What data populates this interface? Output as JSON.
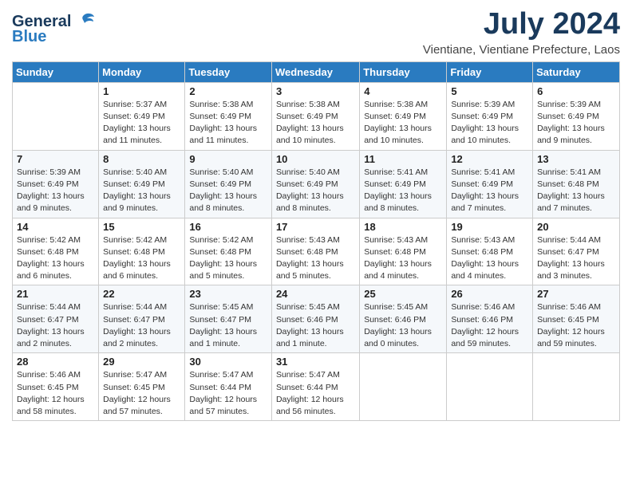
{
  "logo": {
    "general": "General",
    "blue": "Blue"
  },
  "title": "July 2024",
  "subtitle": "Vientiane, Vientiane Prefecture, Laos",
  "days_of_week": [
    "Sunday",
    "Monday",
    "Tuesday",
    "Wednesday",
    "Thursday",
    "Friday",
    "Saturday"
  ],
  "weeks": [
    [
      {
        "day": "",
        "sunrise": "",
        "sunset": "",
        "daylight": ""
      },
      {
        "day": "1",
        "sunrise": "Sunrise: 5:37 AM",
        "sunset": "Sunset: 6:49 PM",
        "daylight": "Daylight: 13 hours and 11 minutes."
      },
      {
        "day": "2",
        "sunrise": "Sunrise: 5:38 AM",
        "sunset": "Sunset: 6:49 PM",
        "daylight": "Daylight: 13 hours and 11 minutes."
      },
      {
        "day": "3",
        "sunrise": "Sunrise: 5:38 AM",
        "sunset": "Sunset: 6:49 PM",
        "daylight": "Daylight: 13 hours and 10 minutes."
      },
      {
        "day": "4",
        "sunrise": "Sunrise: 5:38 AM",
        "sunset": "Sunset: 6:49 PM",
        "daylight": "Daylight: 13 hours and 10 minutes."
      },
      {
        "day": "5",
        "sunrise": "Sunrise: 5:39 AM",
        "sunset": "Sunset: 6:49 PM",
        "daylight": "Daylight: 13 hours and 10 minutes."
      },
      {
        "day": "6",
        "sunrise": "Sunrise: 5:39 AM",
        "sunset": "Sunset: 6:49 PM",
        "daylight": "Daylight: 13 hours and 9 minutes."
      }
    ],
    [
      {
        "day": "7",
        "sunrise": "Sunrise: 5:39 AM",
        "sunset": "Sunset: 6:49 PM",
        "daylight": "Daylight: 13 hours and 9 minutes."
      },
      {
        "day": "8",
        "sunrise": "Sunrise: 5:40 AM",
        "sunset": "Sunset: 6:49 PM",
        "daylight": "Daylight: 13 hours and 9 minutes."
      },
      {
        "day": "9",
        "sunrise": "Sunrise: 5:40 AM",
        "sunset": "Sunset: 6:49 PM",
        "daylight": "Daylight: 13 hours and 8 minutes."
      },
      {
        "day": "10",
        "sunrise": "Sunrise: 5:40 AM",
        "sunset": "Sunset: 6:49 PM",
        "daylight": "Daylight: 13 hours and 8 minutes."
      },
      {
        "day": "11",
        "sunrise": "Sunrise: 5:41 AM",
        "sunset": "Sunset: 6:49 PM",
        "daylight": "Daylight: 13 hours and 8 minutes."
      },
      {
        "day": "12",
        "sunrise": "Sunrise: 5:41 AM",
        "sunset": "Sunset: 6:49 PM",
        "daylight": "Daylight: 13 hours and 7 minutes."
      },
      {
        "day": "13",
        "sunrise": "Sunrise: 5:41 AM",
        "sunset": "Sunset: 6:48 PM",
        "daylight": "Daylight: 13 hours and 7 minutes."
      }
    ],
    [
      {
        "day": "14",
        "sunrise": "Sunrise: 5:42 AM",
        "sunset": "Sunset: 6:48 PM",
        "daylight": "Daylight: 13 hours and 6 minutes."
      },
      {
        "day": "15",
        "sunrise": "Sunrise: 5:42 AM",
        "sunset": "Sunset: 6:48 PM",
        "daylight": "Daylight: 13 hours and 6 minutes."
      },
      {
        "day": "16",
        "sunrise": "Sunrise: 5:42 AM",
        "sunset": "Sunset: 6:48 PM",
        "daylight": "Daylight: 13 hours and 5 minutes."
      },
      {
        "day": "17",
        "sunrise": "Sunrise: 5:43 AM",
        "sunset": "Sunset: 6:48 PM",
        "daylight": "Daylight: 13 hours and 5 minutes."
      },
      {
        "day": "18",
        "sunrise": "Sunrise: 5:43 AM",
        "sunset": "Sunset: 6:48 PM",
        "daylight": "Daylight: 13 hours and 4 minutes."
      },
      {
        "day": "19",
        "sunrise": "Sunrise: 5:43 AM",
        "sunset": "Sunset: 6:48 PM",
        "daylight": "Daylight: 13 hours and 4 minutes."
      },
      {
        "day": "20",
        "sunrise": "Sunrise: 5:44 AM",
        "sunset": "Sunset: 6:47 PM",
        "daylight": "Daylight: 13 hours and 3 minutes."
      }
    ],
    [
      {
        "day": "21",
        "sunrise": "Sunrise: 5:44 AM",
        "sunset": "Sunset: 6:47 PM",
        "daylight": "Daylight: 13 hours and 2 minutes."
      },
      {
        "day": "22",
        "sunrise": "Sunrise: 5:44 AM",
        "sunset": "Sunset: 6:47 PM",
        "daylight": "Daylight: 13 hours and 2 minutes."
      },
      {
        "day": "23",
        "sunrise": "Sunrise: 5:45 AM",
        "sunset": "Sunset: 6:47 PM",
        "daylight": "Daylight: 13 hours and 1 minute."
      },
      {
        "day": "24",
        "sunrise": "Sunrise: 5:45 AM",
        "sunset": "Sunset: 6:46 PM",
        "daylight": "Daylight: 13 hours and 1 minute."
      },
      {
        "day": "25",
        "sunrise": "Sunrise: 5:45 AM",
        "sunset": "Sunset: 6:46 PM",
        "daylight": "Daylight: 13 hours and 0 minutes."
      },
      {
        "day": "26",
        "sunrise": "Sunrise: 5:46 AM",
        "sunset": "Sunset: 6:46 PM",
        "daylight": "Daylight: 12 hours and 59 minutes."
      },
      {
        "day": "27",
        "sunrise": "Sunrise: 5:46 AM",
        "sunset": "Sunset: 6:45 PM",
        "daylight": "Daylight: 12 hours and 59 minutes."
      }
    ],
    [
      {
        "day": "28",
        "sunrise": "Sunrise: 5:46 AM",
        "sunset": "Sunset: 6:45 PM",
        "daylight": "Daylight: 12 hours and 58 minutes."
      },
      {
        "day": "29",
        "sunrise": "Sunrise: 5:47 AM",
        "sunset": "Sunset: 6:45 PM",
        "daylight": "Daylight: 12 hours and 57 minutes."
      },
      {
        "day": "30",
        "sunrise": "Sunrise: 5:47 AM",
        "sunset": "Sunset: 6:44 PM",
        "daylight": "Daylight: 12 hours and 57 minutes."
      },
      {
        "day": "31",
        "sunrise": "Sunrise: 5:47 AM",
        "sunset": "Sunset: 6:44 PM",
        "daylight": "Daylight: 12 hours and 56 minutes."
      },
      {
        "day": "",
        "sunrise": "",
        "sunset": "",
        "daylight": ""
      },
      {
        "day": "",
        "sunrise": "",
        "sunset": "",
        "daylight": ""
      },
      {
        "day": "",
        "sunrise": "",
        "sunset": "",
        "daylight": ""
      }
    ]
  ]
}
